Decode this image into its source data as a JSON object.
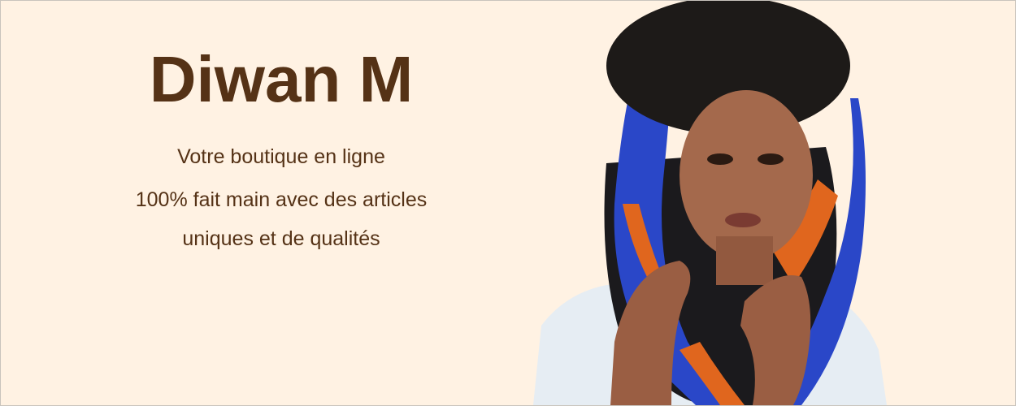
{
  "brand": {
    "title": "Diwan M"
  },
  "tagline": {
    "line1": "Votre boutique en ligne",
    "line2": "100% fait main avec des articles",
    "line3": "uniques et de qualités"
  },
  "colors": {
    "background": "#fff2e3",
    "text": "#553216",
    "scarf_blue": "#2a47c8",
    "scarf_orange": "#e0661e"
  },
  "image": {
    "subject": "model-wearing-african-print-scarf"
  }
}
